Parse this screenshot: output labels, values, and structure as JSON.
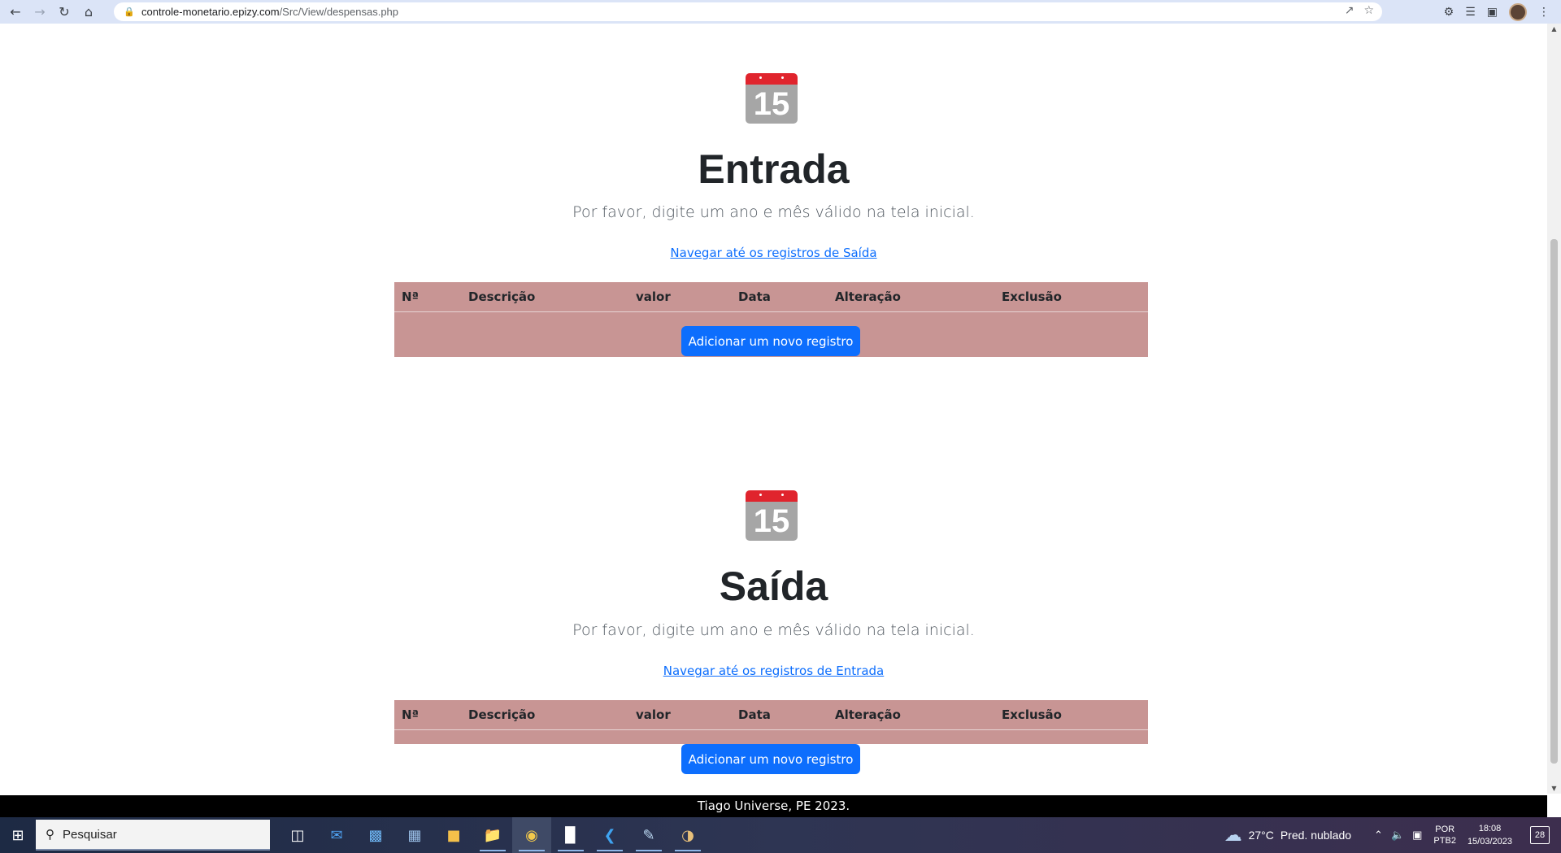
{
  "browser": {
    "url_domain": "controle-monetario.epizy.com",
    "url_path": "/Src/View/despensas.php"
  },
  "sections": [
    {
      "calendar_number": "15",
      "title": "Entrada",
      "subtitle": "Por favor, digite um ano e mês válido na tela inicial.",
      "nav_link": "Navegar até os registros de Saída",
      "columns": [
        "Nª",
        "Descrição",
        "valor",
        "Data",
        "Alteração",
        "Exclusão"
      ],
      "add_button": "Adicionar um novo registro"
    },
    {
      "calendar_number": "15",
      "title": "Saída",
      "subtitle": "Por favor, digite um ano e mês válido na tela inicial.",
      "nav_link": "Navegar até os registros de Entrada",
      "columns": [
        "Nª",
        "Descrição",
        "valor",
        "Data",
        "Alteração",
        "Exclusão"
      ],
      "add_button": "Adicionar um novo registro"
    }
  ],
  "footer": "Tiago Universe, PE 2023.",
  "taskbar": {
    "search_placeholder": "Pesquisar",
    "weather_temp": "27°C",
    "weather_text": "Pred. nublado",
    "lang_top": "POR",
    "lang_bottom": "PTB2",
    "time": "18:08",
    "date": "15/03/2023",
    "notifications": "28"
  },
  "colors": {
    "table_bg": "#c89594",
    "button": "#0d6efd",
    "calendar_red": "#e0242d",
    "calendar_gray": "#a6a6a6",
    "footer_bg": "#000000"
  }
}
